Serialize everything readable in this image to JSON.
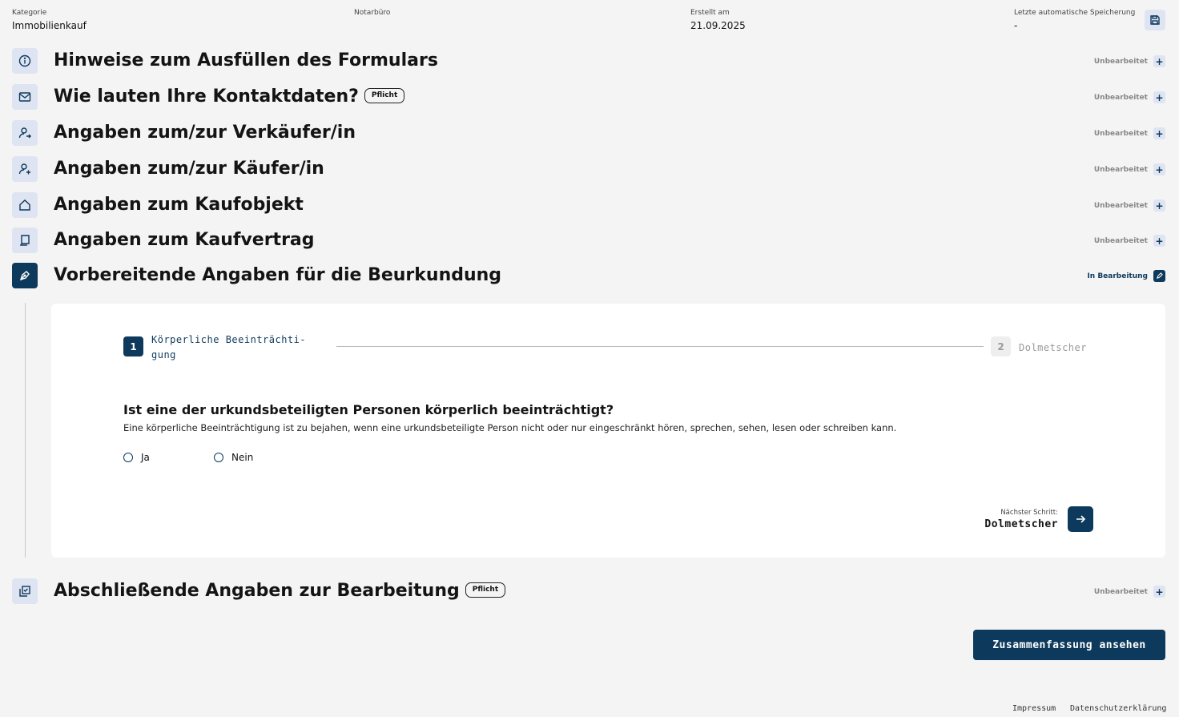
{
  "header": {
    "kategorie_label": "Kategorie",
    "kategorie_value": "Immobilienkauf",
    "notarbuero_label": "Notarbüro",
    "notarbuero_value": "",
    "erstellt_label": "Erstellt am",
    "erstellt_value": "21.09.2025",
    "speicherung_label": "Letzte automatische Speicherung",
    "speicherung_value": "-",
    "save_icon": "floppy-disk-icon"
  },
  "sections": [
    {
      "title": "Hinweise zum Ausfüllen des Formulars",
      "badge": "",
      "status": "Unbearbeitet",
      "icon": "info-icon"
    },
    {
      "title": "Wie lauten Ihre Kontaktdaten?",
      "badge": "Pflicht",
      "status": "Unbearbeitet",
      "icon": "mail-icon"
    },
    {
      "title": "Angaben zum/zur Verkäufer/in",
      "badge": "",
      "status": "Unbearbeitet",
      "icon": "user-arrow-icon"
    },
    {
      "title": "Angaben zum/zur Käufer/in",
      "badge": "",
      "status": "Unbearbeitet",
      "icon": "user-plus-icon"
    },
    {
      "title": "Angaben zum Kaufobjekt",
      "badge": "",
      "status": "Unbearbeitet",
      "icon": "house-icon"
    },
    {
      "title": "Angaben zum Kaufvertrag",
      "badge": "",
      "status": "Unbearbeitet",
      "icon": "document-icon"
    },
    {
      "title": "Vorbereitende Angaben für die Beurkundung",
      "badge": "",
      "status": "In Bearbeitung",
      "icon": "pen-nib-icon"
    },
    {
      "title": "Abschließende Angaben zur Bearbeitung",
      "badge": "Pflicht",
      "status": "Unbearbeitet",
      "icon": "checklist-icon"
    }
  ],
  "stepper": {
    "step1_num": "1",
    "step1_label_a": "Körperliche Beeinträchti-",
    "step1_label_b": "gung",
    "step2_num": "2",
    "step2_label": "Dolmetscher"
  },
  "question": {
    "title": "Ist eine der urkundsbeteiligten Personen körperlich beeinträchtigt?",
    "description": "Eine körperliche Beeinträchtigung ist zu bejahen, wenn eine urkundsbeteiligte Person nicht oder nur eingeschränkt hören, sprechen, sehen, lesen oder schreiben kann.",
    "option_yes": "Ja",
    "option_no": "Nein"
  },
  "next_step": {
    "label": "Nächster Schritt:",
    "value": "Dolmetscher"
  },
  "summary_button": "Zusammenfassung ansehen",
  "footer": {
    "impressum": "Impressum",
    "datenschutz": "Datenschutzerklärung"
  },
  "colors": {
    "primary": "#0d3a5c",
    "icon_bg": "#dfe4f3",
    "page_bg": "#f4f4f4"
  }
}
